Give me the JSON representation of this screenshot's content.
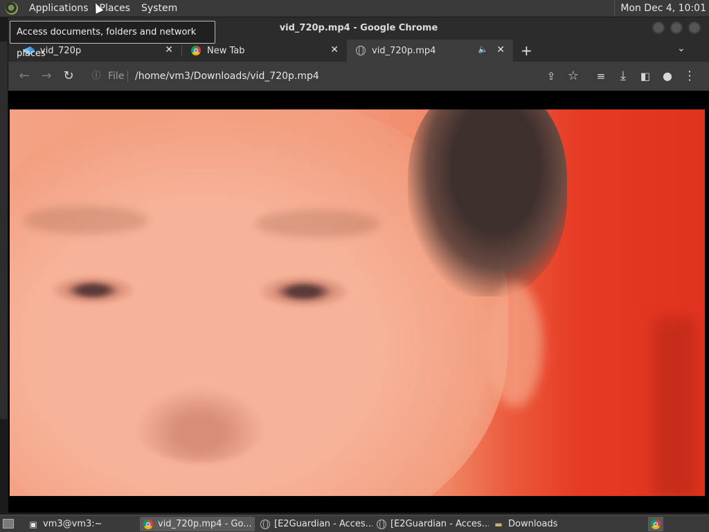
{
  "top_panel": {
    "menus": [
      "Applications",
      "Places",
      "System"
    ],
    "clock": "Mon Dec 4, 10:01"
  },
  "tooltip": "Access documents, folders and network places",
  "window": {
    "title": "vid_720p.mp4 - Google Chrome",
    "tabs": [
      {
        "label": "vid_720p",
        "icon": "video-favicon-icon"
      },
      {
        "label": "New Tab",
        "icon": "chrome-icon"
      },
      {
        "label": "vid_720p.mp4",
        "icon": "globe-icon",
        "active": true
      }
    ],
    "omnibox": {
      "info_label": "File",
      "url": "/home/vm3/Downloads/vid_720p.mp4"
    }
  },
  "taskbar": {
    "items": [
      {
        "label": "vm3@vm3:~",
        "icon": "terminal-icon"
      },
      {
        "label": "vid_720p.mp4 - Go...",
        "icon": "chrome-icon",
        "active": true
      },
      {
        "label": "[E2Guardian - Acces...",
        "icon": "globe-icon"
      },
      {
        "label": "[E2Guardian - Acces...",
        "icon": "globe-icon"
      },
      {
        "label": "Downloads",
        "icon": "folder-icon"
      }
    ]
  }
}
